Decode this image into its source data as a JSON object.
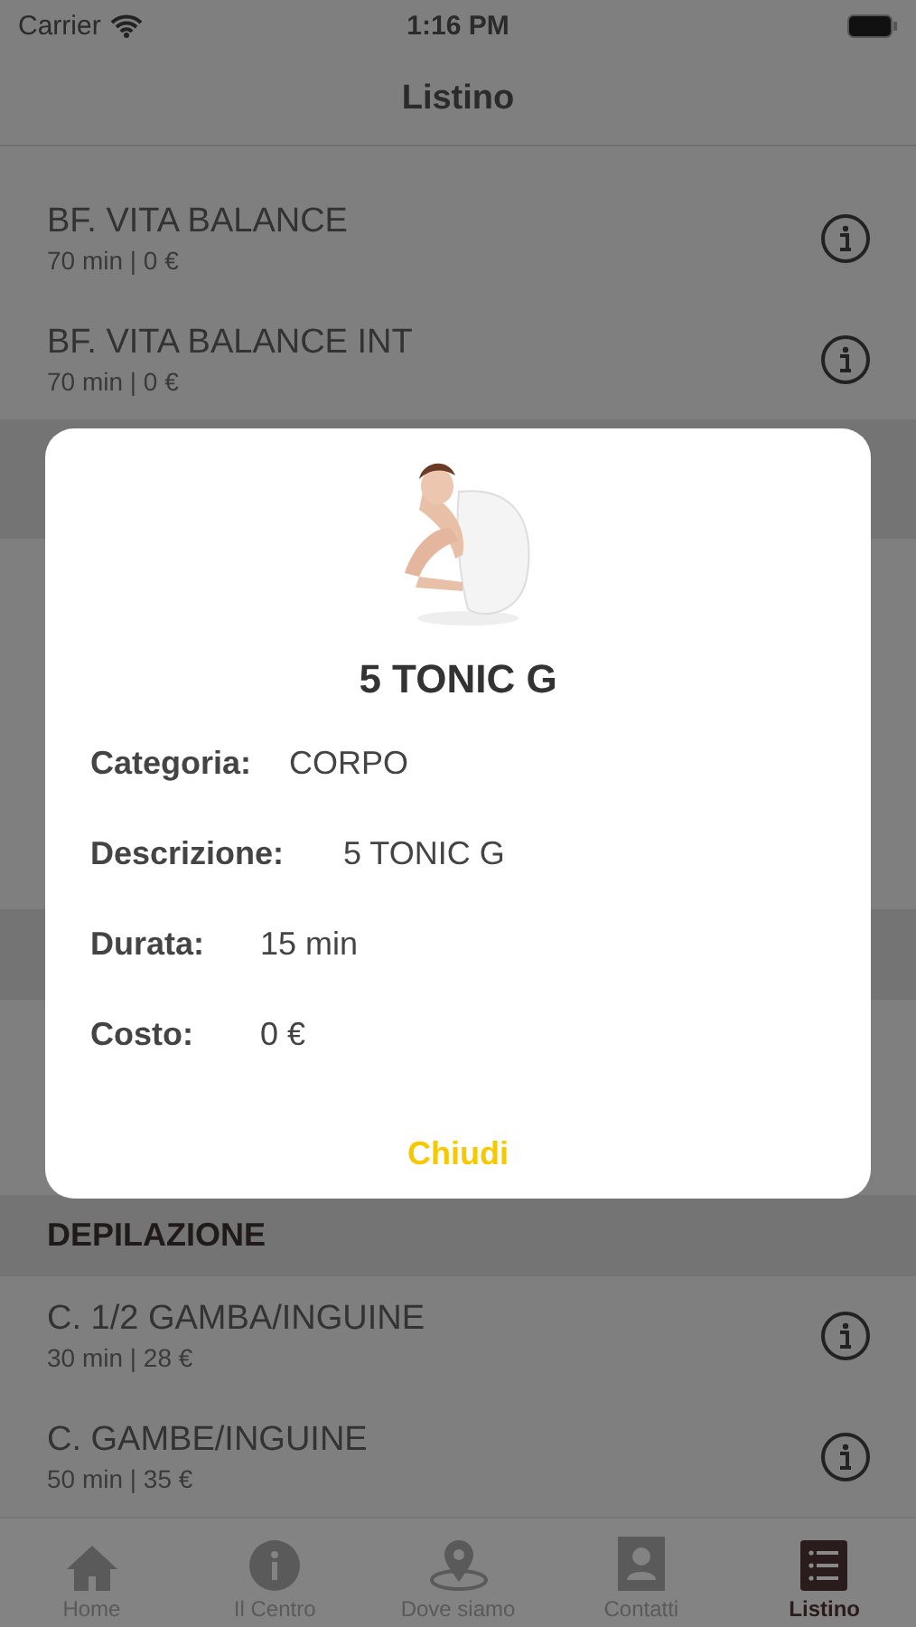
{
  "status_bar": {
    "carrier": "Carrier",
    "time": "1:16 PM"
  },
  "nav": {
    "title": "Listino"
  },
  "items": [
    {
      "name": "BF. VITA BALANCE",
      "detail": "70 min | 0 €"
    },
    {
      "name": "BF. VITA BALANCE INT",
      "detail": "70 min | 0 €"
    }
  ],
  "modal": {
    "title": "5 TONIC G",
    "fields": [
      {
        "label": "Categoria:",
        "value": "CORPO"
      },
      {
        "label": "Descrizione:",
        "value": "5 TONIC G"
      },
      {
        "label": "Durata:",
        "value": "15 min"
      },
      {
        "label": "Costo:",
        "value": "0 €"
      }
    ],
    "close": "Chiudi"
  },
  "section": {
    "title": "DEPILAZIONE",
    "items": [
      {
        "name": "C. 1/2 GAMBA/INGUINE",
        "detail": "30 min | 28 €"
      },
      {
        "name": "C. GAMBE/INGUINE",
        "detail": "50 min | 35 €"
      }
    ]
  },
  "tabs": [
    {
      "label": "Home",
      "selected": false
    },
    {
      "label": "Il Centro",
      "selected": false
    },
    {
      "label": "Dove siamo",
      "selected": false
    },
    {
      "label": "Contatti",
      "selected": false
    },
    {
      "label": "Listino",
      "selected": true
    }
  ]
}
